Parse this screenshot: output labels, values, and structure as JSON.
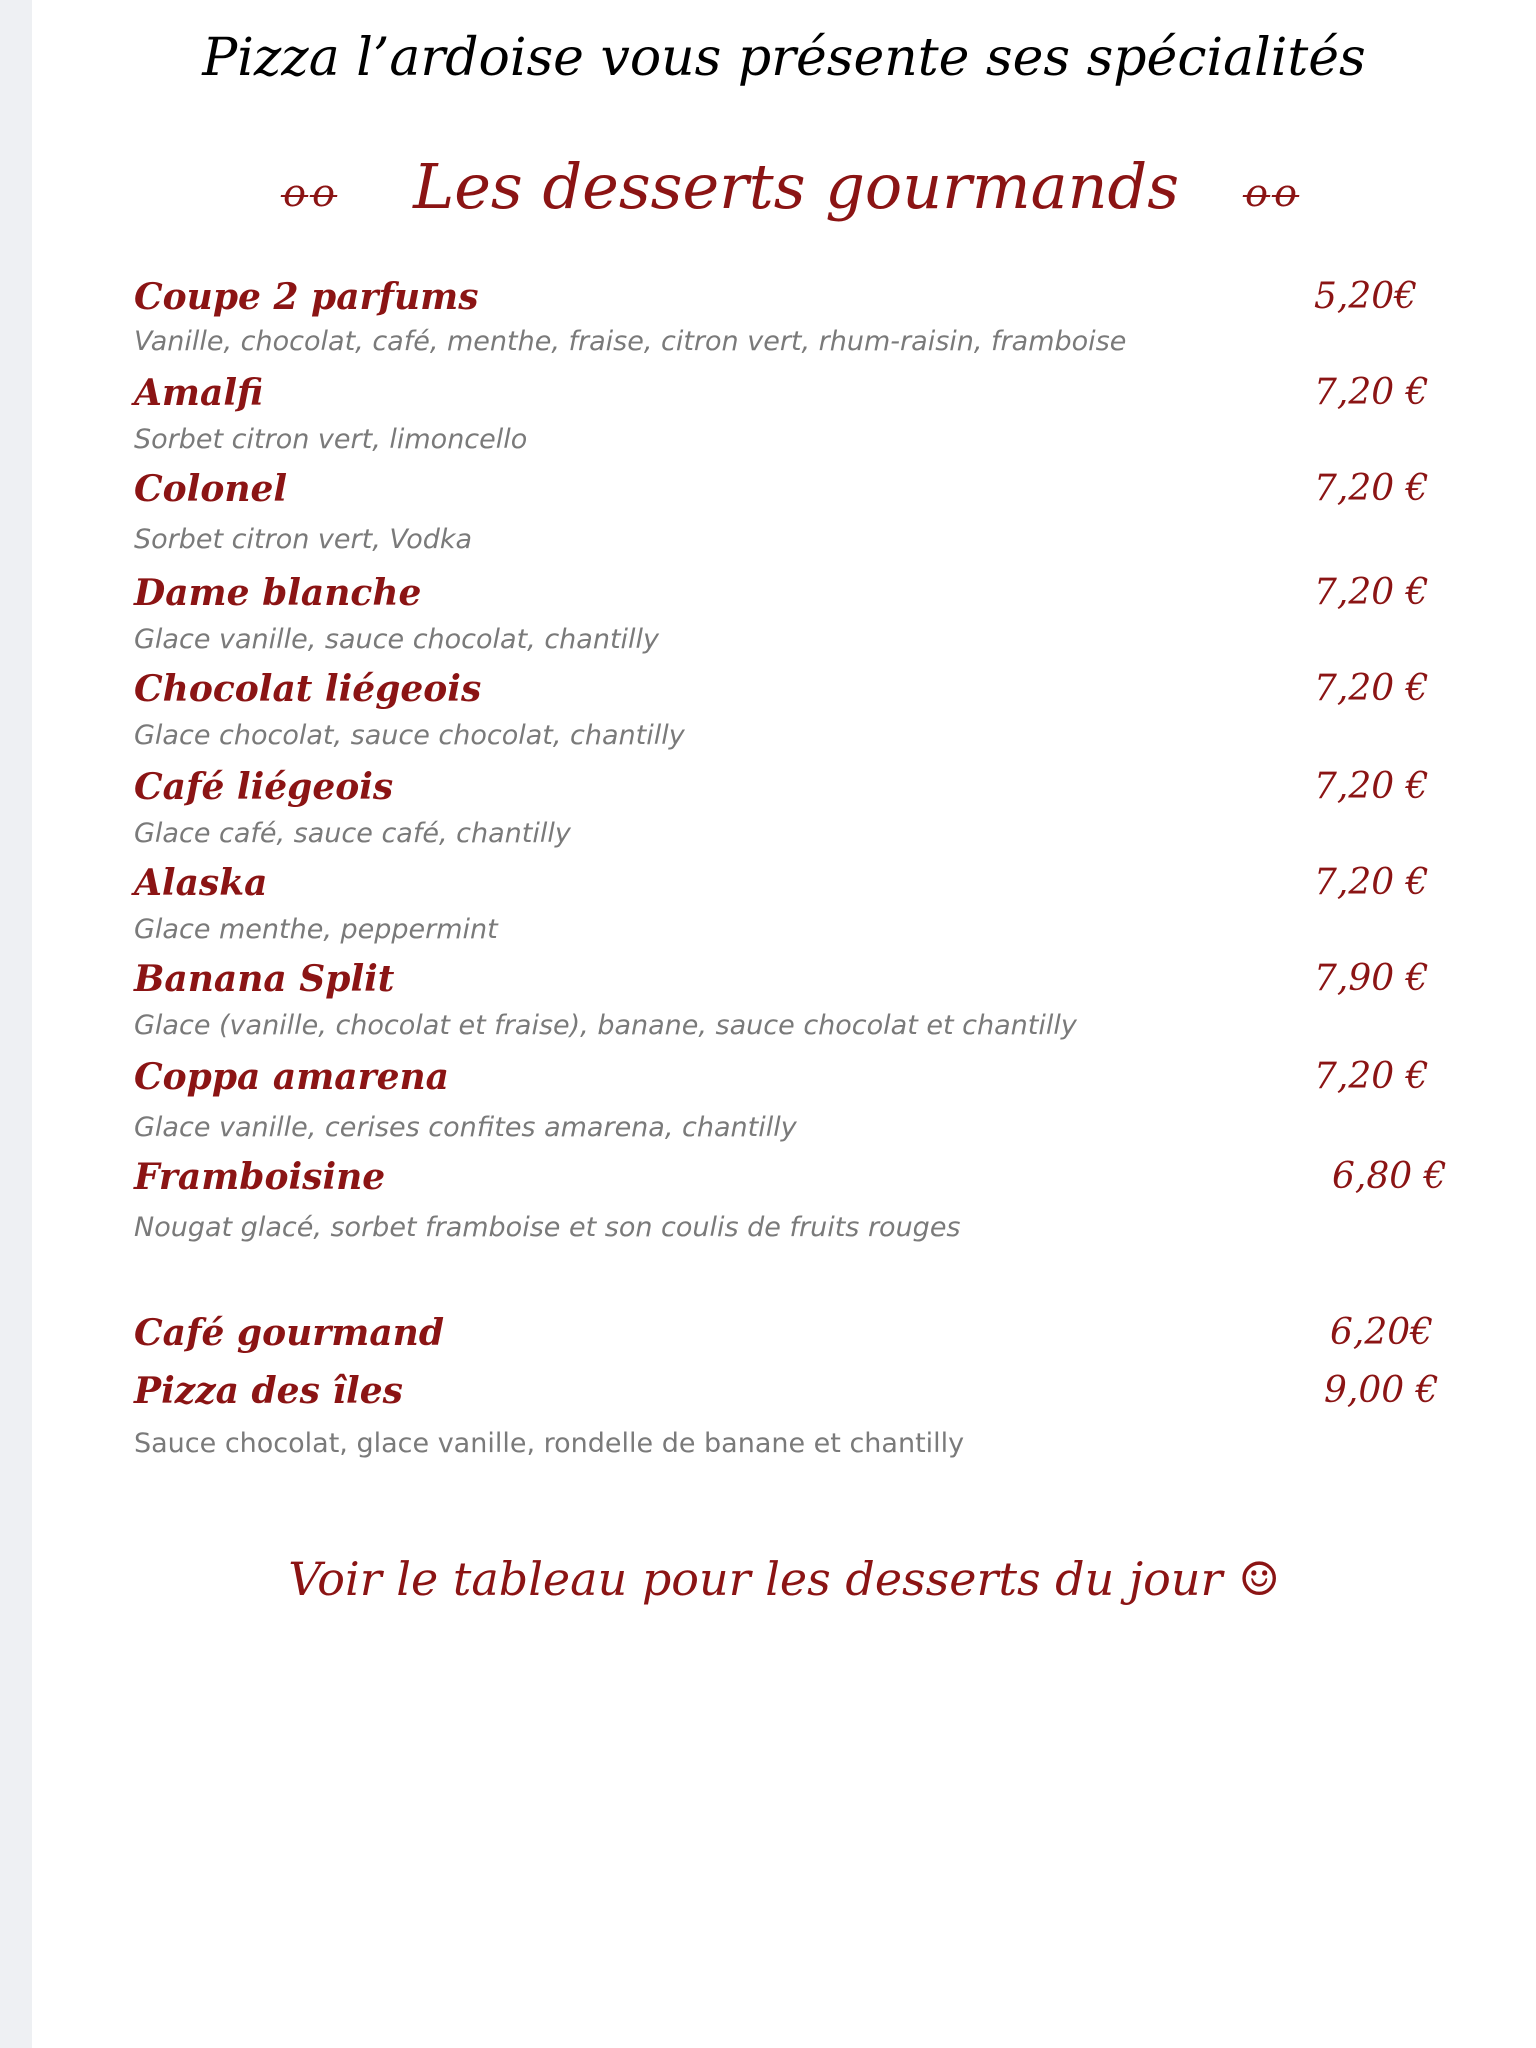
{
  "header": {
    "title": "Pizza l’ardoise vous présente ses spécialités"
  },
  "section": {
    "ornament_left": " ꝋꝋ",
    "title": "Les desserts gourmands",
    "ornament_right": "ꝋꝋ"
  },
  "items": [
    {
      "name": "Coupe 2 parfums",
      "price": "5,20€",
      "description": "Vanille, chocolat, café, menthe,  fraise, citron vert, rhum-raisin, framboise"
    },
    {
      "name": "Amalfi",
      "price": "7,20 €",
      "description": "Sorbet citron vert, limoncello"
    },
    {
      "name": "Colonel",
      "price": "7,20 €",
      "description": "Sorbet citron vert, Vodka"
    },
    {
      "name": "Dame blanche",
      "price": "7,20 €",
      "description": "Glace vanille, sauce chocolat, chantilly"
    },
    {
      "name": "Chocolat liégeois",
      "price": "7,20 €",
      "description": "Glace chocolat, sauce chocolat, chantilly"
    },
    {
      "name": "Café liégeois",
      "price": "7,20 €",
      "description": "Glace café, sauce café, chantilly"
    },
    {
      "name": "Alaska",
      "price": "7,20 €",
      "description": "Glace menthe, peppermint"
    },
    {
      "name": "Banana Split",
      "price": "7,90 €",
      "description": "Glace (vanille, chocolat et fraise), banane, sauce chocolat et chantilly"
    },
    {
      "name": "Coppa amarena",
      "price": "7,20 €",
      "description": "Glace vanille, cerises confites amarena, chantilly"
    },
    {
      "name": "Framboisine",
      "price": "6,80 €",
      "description": "Nougat glacé, sorbet framboise et son coulis de fruits rouges"
    },
    {
      "name": "Café gourmand",
      "price": "6,20€",
      "description": ""
    },
    {
      "name": "Pizza des îles",
      "price": "9,00 €",
      "description": "Sauce chocolat, glace vanille, rondelle de banane et chantilly"
    }
  ],
  "footer": {
    "note": "Voir le tableau pour les desserts du jour",
    "smiley": "☺"
  },
  "colors": {
    "accent": "#8b1414",
    "description": "#7a7a7a",
    "page_background": "#ffffff",
    "margin_background": "#eef0f3"
  }
}
